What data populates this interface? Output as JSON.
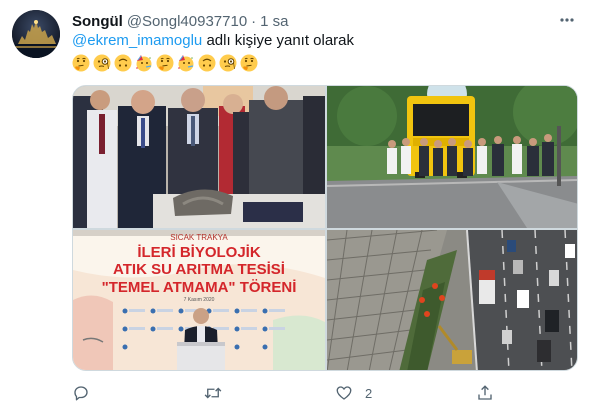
{
  "tweet": {
    "author_name": "Songül",
    "author_handle": "@Songl40937710",
    "separator": "·",
    "time": "1 sa",
    "reply_mention": "@ekrem_imamoglu",
    "reply_suffix": " adlı kişiye yanıt olarak",
    "emojis": [
      "thinking-face-icon",
      "face-with-monocle-icon",
      "upside-down-face-icon",
      "partying-face-icon",
      "thinking-face-icon",
      "partying-face-icon",
      "upside-down-face-icon",
      "face-with-monocle-icon",
      "thinking-face-icon"
    ]
  },
  "media": {
    "photo3_banner": {
      "line0": "SICAK TRAKYA",
      "line1": "İLERİ BİYOLOJİK",
      "line2": "ATIK SU ARITMA TESİSİ",
      "line3": "\"TEMEL ATMAMA\" TÖRENİ",
      "date": "7 Kasım 2020"
    }
  },
  "actions": {
    "reply_count": "",
    "retweet_count": "",
    "like_count": "2",
    "share_count": ""
  },
  "colors": {
    "link": "#1d9bf0",
    "secondary_text": "#536471",
    "primary_text": "#0f1419",
    "border": "#cfd9de",
    "banner_red": "#d4262b"
  }
}
